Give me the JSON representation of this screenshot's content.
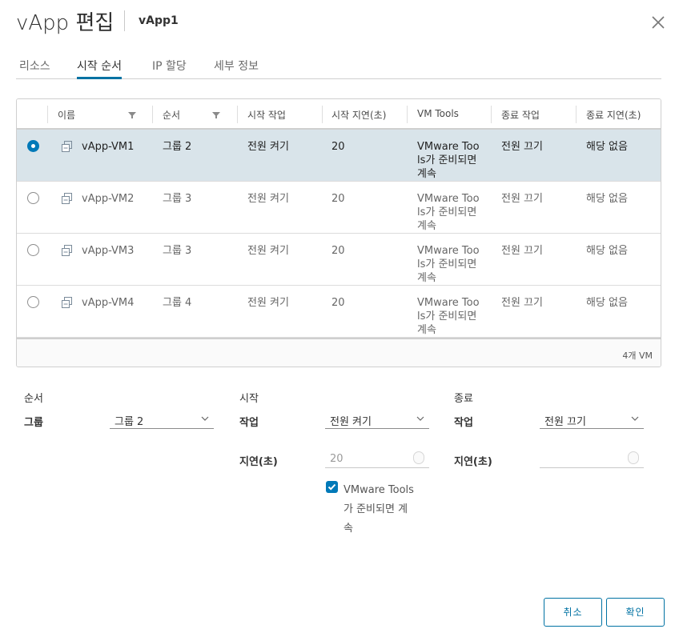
{
  "dialog": {
    "title": "vApp 편집",
    "subtitle": "vApp1"
  },
  "tabs": [
    {
      "label": "리소스",
      "active": false
    },
    {
      "label": "시작 순서",
      "active": true
    },
    {
      "label": "IP 할당",
      "active": false
    },
    {
      "label": "세부 정보",
      "active": false
    }
  ],
  "grid": {
    "columns": [
      "이름",
      "순서",
      "시작 작업",
      "시작 지연(초)",
      "VM Tools",
      "종료 작업",
      "종료 지연(초)"
    ],
    "rows": [
      {
        "selected": true,
        "name": "vApp-VM1",
        "order": "그룹 2",
        "start_action": "전원 켜기",
        "start_delay": "20",
        "vm_tools": [
          "VMware Too",
          "ls가 준비되면",
          "계속"
        ],
        "stop_action": "전원 끄기",
        "stop_delay": "해당 없음"
      },
      {
        "selected": false,
        "name": "vApp-VM2",
        "order": "그룹 3",
        "start_action": "전원 켜기",
        "start_delay": "20",
        "vm_tools": [
          "VMware Too",
          "ls가 준비되면",
          "계속"
        ],
        "stop_action": "전원 끄기",
        "stop_delay": "해당 없음"
      },
      {
        "selected": false,
        "name": "vApp-VM3",
        "order": "그룹 3",
        "start_action": "전원 켜기",
        "start_delay": "20",
        "vm_tools": [
          "VMware Too",
          "ls가 준비되면",
          "계속"
        ],
        "stop_action": "전원 끄기",
        "stop_delay": "해당 없음"
      },
      {
        "selected": false,
        "name": "vApp-VM4",
        "order": "그룹 4",
        "start_action": "전원 켜기",
        "start_delay": "20",
        "vm_tools": [
          "VMware Too",
          "ls가 준비되면",
          "계속"
        ],
        "stop_action": "전원 끄기",
        "stop_delay": "해당 없음"
      }
    ],
    "footer": "4개 VM"
  },
  "order_section": {
    "title": "순서",
    "group_label": "그룹",
    "group_value": "그룹 2"
  },
  "start_section": {
    "title": "시작",
    "action_label": "작업",
    "action_value": "전원 켜기",
    "delay_label": "지연(초)",
    "delay_placeholder": "20",
    "vmtools_checked": true,
    "vmtools_label_lines": [
      "VMware Tools",
      "가 준비되면 계",
      "속"
    ]
  },
  "stop_section": {
    "title": "종료",
    "action_label": "작업",
    "action_value": "전원 끄기",
    "delay_label": "지연(초)",
    "delay_value": ""
  },
  "buttons": {
    "cancel": "취소",
    "ok": "확인"
  },
  "colors": {
    "accent": "#0072a3",
    "selected_row": "#d9e4ea",
    "checkbox": "#0079b8"
  }
}
